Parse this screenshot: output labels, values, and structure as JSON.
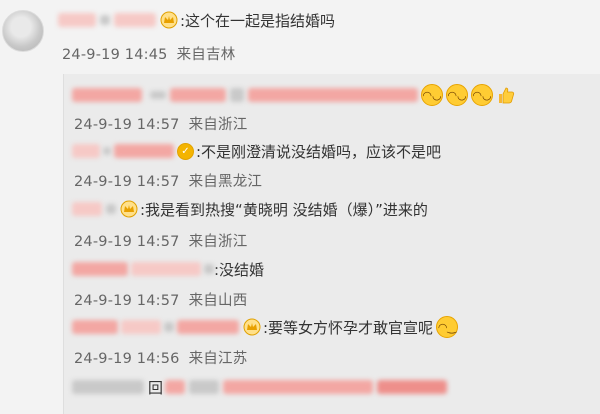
{
  "comment": {
    "text": ":这个在一起是指结婚吗",
    "date": "24-9-19 14:45",
    "location": "来自吉林"
  },
  "replies": [
    {
      "text": "",
      "date": "24-9-19 14:57",
      "location": "来自浙江",
      "emojis": [
        "laugh",
        "laugh",
        "laugh",
        "thumbs-up"
      ]
    },
    {
      "text": ":不是刚澄清说没结婚吗，应该不是吧",
      "date": "24-9-19 14:57",
      "location": "来自黑龙江"
    },
    {
      "text": ":我是看到热搜“黄晓明  没结婚（爆）”进来的",
      "date": "24-9-19 14:57",
      "location": "来自浙江"
    },
    {
      "text": ":没结婚",
      "date": "24-9-19 14:57",
      "location": "来自山西"
    },
    {
      "text": ":要等女方怀孕才敢官宣呢",
      "date": "24-9-19 14:56",
      "location": "来自江苏",
      "emojis": [
        "smile"
      ]
    },
    {
      "text": "回",
      "partial": true
    }
  ],
  "colors": {
    "badge_gold": "#f4b400",
    "blur_pink": "#f3a7a3",
    "meta_grey": "#666666"
  }
}
